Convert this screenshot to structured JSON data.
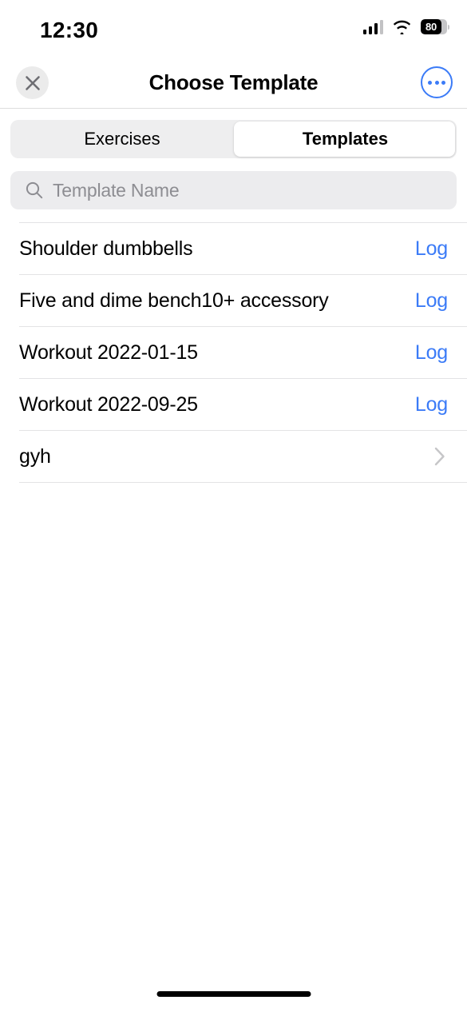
{
  "status_bar": {
    "time": "12:30",
    "cellular_icon": "cellular-bars-icon",
    "wifi_icon": "wifi-icon",
    "battery_icon": "battery-icon",
    "battery_percent": "80"
  },
  "nav_bar": {
    "title": "Choose Template",
    "close_icon": "close-x-icon",
    "more_icon": "ellipsis-circle-icon"
  },
  "segmented_control": {
    "options": [
      {
        "label": "Exercises",
        "selected": false
      },
      {
        "label": "Templates",
        "selected": true
      }
    ],
    "selected_index": 1
  },
  "search": {
    "icon": "search-magnifier-icon",
    "value": "",
    "placeholder": "Template Name"
  },
  "list": {
    "rows": [
      {
        "label": "Shoulder dumbbells",
        "action": "Log",
        "accessory": "text"
      },
      {
        "label": "Five and dime bench10+ accessory",
        "action": "Log",
        "accessory": "text"
      },
      {
        "label": "Workout 2022-01-15",
        "action": "Log",
        "accessory": "text"
      },
      {
        "label": "Workout 2022-09-25",
        "action": "Log",
        "accessory": "text"
      },
      {
        "label": "gyh",
        "action": "",
        "accessory": "chevron"
      }
    ]
  },
  "home_indicator": "home-indicator",
  "colors": {
    "accent_blue": "#3b7bf7",
    "separator": "#e3e3e5",
    "field_bg": "#ececee",
    "segment_bg": "#eeeeef",
    "close_bg": "#ebebeb",
    "text_primary": "#000000",
    "placeholder": "#8d8d92",
    "chevron": "#c6c6c8"
  }
}
